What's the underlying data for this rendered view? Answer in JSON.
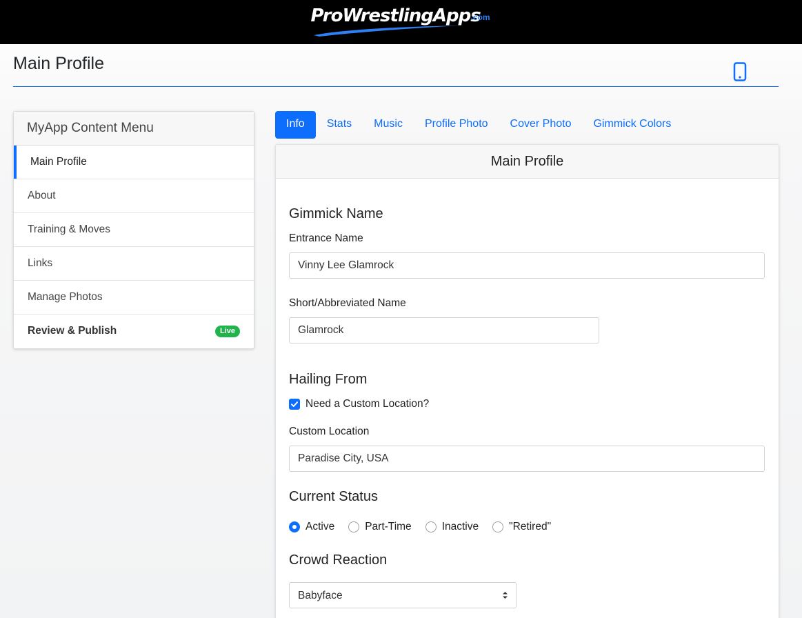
{
  "brand": {
    "name": "ProWrestlingApps",
    "suffix": ".com"
  },
  "page": {
    "title": "Main Profile"
  },
  "menu": {
    "header": "MyApp Content Menu",
    "items": [
      {
        "label": "Main Profile",
        "active": true
      },
      {
        "label": "About"
      },
      {
        "label": "Training & Moves"
      },
      {
        "label": "Links"
      },
      {
        "label": "Manage Photos"
      },
      {
        "label": "Review & Publish",
        "badge": "Live"
      }
    ]
  },
  "tabs": [
    {
      "label": "Info",
      "active": true
    },
    {
      "label": "Stats"
    },
    {
      "label": "Music"
    },
    {
      "label": "Profile Photo"
    },
    {
      "label": "Cover Photo"
    },
    {
      "label": "Gimmick Colors"
    }
  ],
  "form": {
    "header": "Main Profile",
    "gimmick_section": "Gimmick Name",
    "entrance_label": "Entrance Name",
    "entrance_value": "Vinny Lee Glamrock",
    "short_label": "Short/Abbreviated Name",
    "short_value": "Glamrock",
    "hailing_section": "Hailing From",
    "custom_location_checkbox": "Need a Custom Location?",
    "custom_location_checked": true,
    "custom_location_label": "Custom Location",
    "custom_location_value": "Paradise City, USA",
    "status_section": "Current Status",
    "status_options": [
      "Active",
      "Part-Time",
      "Inactive",
      "\"Retired\""
    ],
    "status_selected": "Active",
    "crowd_section": "Crowd Reaction",
    "crowd_value": "Babyface"
  },
  "colors": {
    "accent": "#0d6efd",
    "live_badge": "#1fb54c",
    "topbar": "#000000"
  },
  "icons": {
    "device": "mobile-phone-icon"
  }
}
